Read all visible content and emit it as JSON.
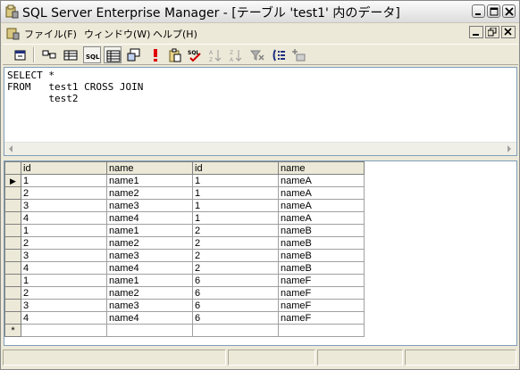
{
  "window": {
    "title": "SQL Server Enterprise Manager - [テーブル 'test1' 内のデータ]"
  },
  "menu": {
    "file": "ファイル(F)",
    "window": "ウィンドウ(W)",
    "help": "ヘルプ(H)"
  },
  "toolbar": {
    "buttons": [
      "properties-icon",
      "diagram-pane-icon",
      "grid-pane-icon",
      "sql-pane-icon",
      "results-pane-icon",
      "change-query-type-icon",
      "run-icon",
      "verify-sql-icon",
      "check-sql-icon",
      "sort-ascending-icon",
      "sort-descending-icon",
      "remove-filter-icon",
      "group-by-icon",
      "add-table-icon"
    ],
    "sql_label": "SQL"
  },
  "sql": {
    "lines": [
      "SELECT *",
      "FROM   test1 CROSS JOIN",
      "       test2"
    ]
  },
  "grid": {
    "columns": [
      "id",
      "name",
      "id",
      "name"
    ],
    "rows": [
      [
        "1",
        "name1",
        "1",
        "nameA"
      ],
      [
        "2",
        "name2",
        "1",
        "nameA"
      ],
      [
        "3",
        "name3",
        "1",
        "nameA"
      ],
      [
        "4",
        "name4",
        "1",
        "nameA"
      ],
      [
        "1",
        "name1",
        "2",
        "nameB"
      ],
      [
        "2",
        "name2",
        "2",
        "nameB"
      ],
      [
        "3",
        "name3",
        "2",
        "nameB"
      ],
      [
        "4",
        "name4",
        "2",
        "nameB"
      ],
      [
        "1",
        "name1",
        "6",
        "nameF"
      ],
      [
        "2",
        "name2",
        "6",
        "nameF"
      ],
      [
        "3",
        "name3",
        "6",
        "nameF"
      ],
      [
        "4",
        "name4",
        "6",
        "nameF"
      ]
    ],
    "current_row_marker": "▶",
    "new_row_marker": "*"
  }
}
